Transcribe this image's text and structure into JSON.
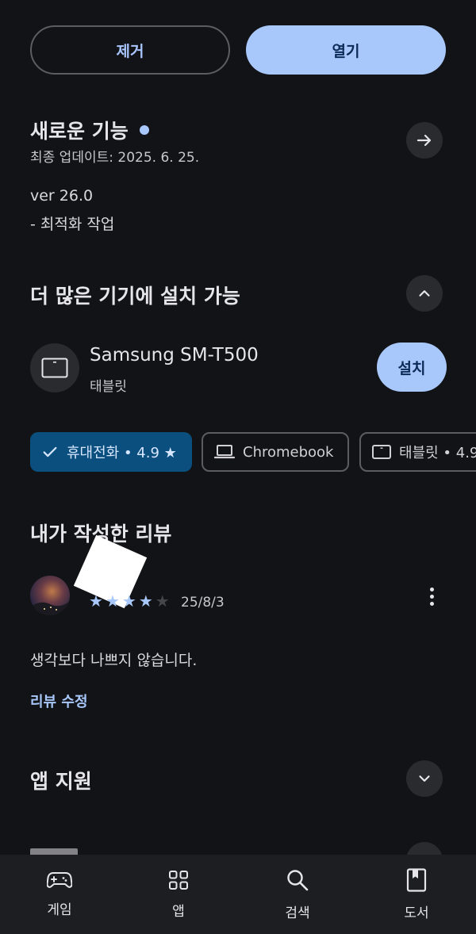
{
  "actions": {
    "remove_label": "제거",
    "open_label": "열기"
  },
  "whats_new": {
    "title": "새로운 기능",
    "updated": "최종 업데이트: 2025. 6. 25.",
    "version": "ver 26.0",
    "notes": "- 최적화 작업"
  },
  "more_devices": {
    "title": "더 많은 기기에 설치 가능",
    "device_name": "Samsung SM-T500",
    "device_type": "태블릿",
    "install_label": "설치"
  },
  "chips": [
    {
      "label": "휴대전화 • 4.9 ★",
      "selected": true
    },
    {
      "label": "Chromebook",
      "selected": false
    },
    {
      "label": "태블릿 • 4.9",
      "selected": false
    }
  ],
  "my_review": {
    "title": "내가 작성한 리뷰",
    "rating": 4,
    "date": "25/8/3",
    "text": "생각보다 나쁘지 않습니다.",
    "edit_label": "리뷰 수정"
  },
  "app_support": {
    "title": "앱 지원"
  },
  "nav": [
    {
      "label": "게임",
      "icon": "gamepad-icon"
    },
    {
      "label": "앱",
      "icon": "apps-grid-icon"
    },
    {
      "label": "검색",
      "icon": "search-icon"
    },
    {
      "label": "도서",
      "icon": "book-icon"
    }
  ],
  "colors": {
    "accent": "#a8c7fa",
    "background": "#121316",
    "chip_selected": "#0b4f7f"
  }
}
